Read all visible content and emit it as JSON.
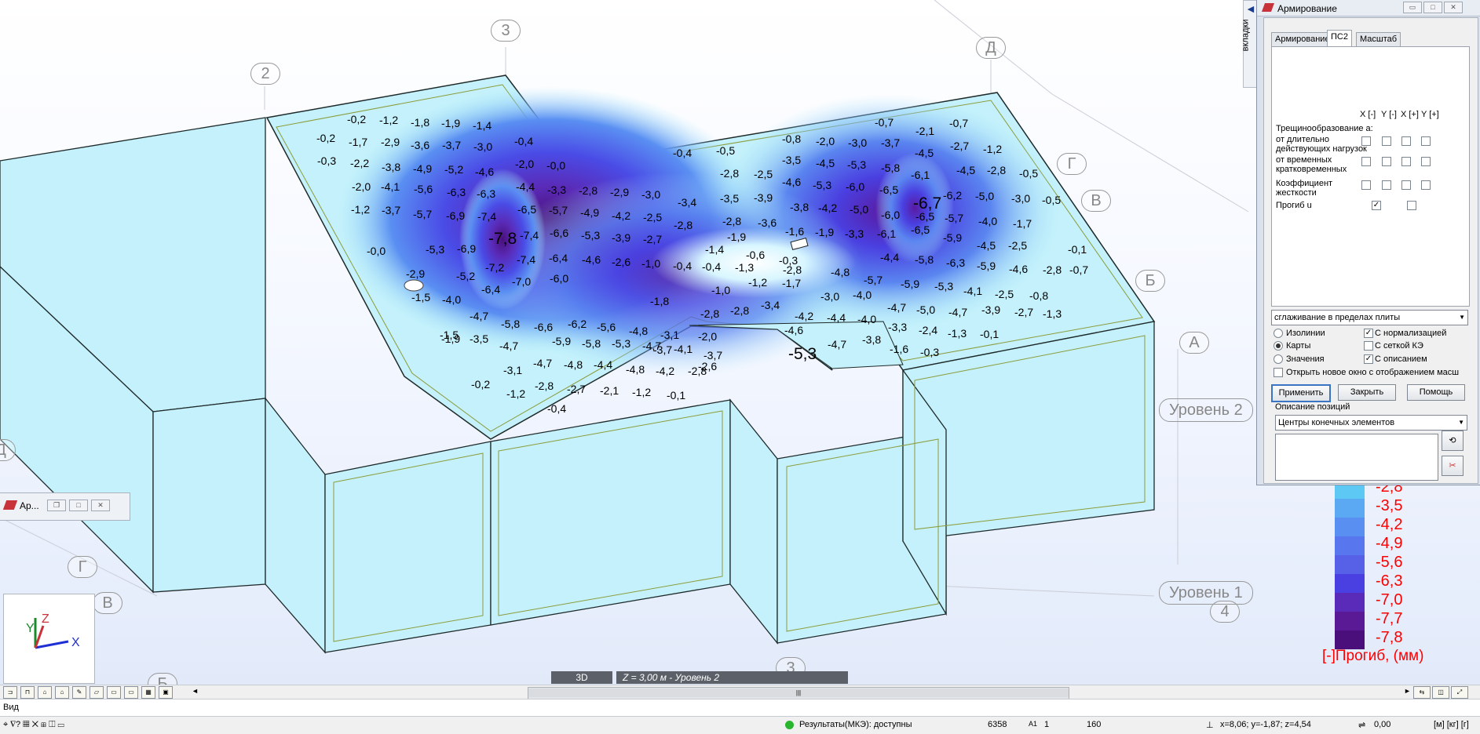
{
  "grid_axes": {
    "labels": [
      "3",
      "2",
      "Д",
      "Г",
      "В",
      "Б",
      "А",
      "Д",
      "Г",
      "В",
      "Б",
      "3",
      "4"
    ]
  },
  "levels": [
    "Уровень 2",
    "Уровень 1"
  ],
  "contour_values": [
    [
      "-0,2",
      "-1,2",
      "-1,8",
      "-1,9",
      "-1,4"
    ],
    [
      "-0,2",
      "-1,7",
      "-2,9",
      "-3,6",
      "-3,7",
      "-3,0",
      "-0,4"
    ],
    [
      "-0,3",
      "-2,2",
      "-3,8",
      "-4,9",
      "-5,2",
      "-4,6",
      "-2,0",
      "-0,0"
    ],
    [
      "-2,0",
      "-4,1",
      "-5,6",
      "-6,3",
      "-6,3",
      "-4,4",
      "-3,3",
      "-2,8",
      "-2,9",
      "-3,0"
    ],
    [
      "-1,2",
      "-3,7",
      "-5,7",
      "-6,9",
      "-7,4",
      "-6,5",
      "-5,7",
      "-4,9",
      "-4,2",
      "-2,5"
    ],
    [
      "-0,0",
      "-5,3",
      "-6,9",
      "-7,8",
      "-7,4",
      "-6,6",
      "-5,3",
      "-3,9",
      "-2,7"
    ],
    [
      "-2,9",
      "-5,2",
      "-7,2",
      "-7,4",
      "-6,4",
      "-4,6",
      "-2,6",
      "-1,0"
    ],
    [
      "-1,5",
      "-4,0",
      "-6,4",
      "-7,0",
      "-6,0"
    ],
    [
      "-1,5",
      "-4,7",
      "-5,8",
      "-6,6",
      "-6,2",
      "-5,6",
      "-4,8",
      "-3,1",
      "-2,0",
      "-1,8"
    ],
    [
      "-1,9",
      "-3,5",
      "-4,7",
      "-5,9",
      "-5,8",
      "-5,3",
      "-4,7",
      "-4,1",
      "-3,7"
    ],
    [
      "-0,2",
      "-3,1",
      "-4,7",
      "-4,8",
      "-4,4",
      "-4,8",
      "-4,2"
    ],
    [
      "-1,2",
      "-2,8",
      "-2,7",
      "-2,1",
      "-1,2",
      "-0,1",
      "-3,7",
      "-2,8",
      "-2,6"
    ],
    [
      "-0,4"
    ],
    [
      "-0,7",
      "-2,1",
      "-0,7"
    ],
    [
      "-0,4",
      "-0,5",
      "-0,8",
      "-2,0",
      "-3,0",
      "-3,7",
      "-4,5",
      "-2,7",
      "-1,2"
    ],
    [
      "-2,8",
      "-2,5",
      "-3,5",
      "-4,5",
      "-5,3",
      "-5,8",
      "-6,1",
      "-4,5",
      "-2,8",
      "-0,5"
    ],
    [
      "-3,4",
      "-3,5",
      "-3,9",
      "-4,6",
      "-5,3",
      "-6,0",
      "-6,5",
      "-6,7",
      "-6,2",
      "-5,0",
      "-3,0",
      "-0,5"
    ],
    [
      "-2,8",
      "-2,8",
      "-3,6",
      "-3,8",
      "-4,2",
      "-5,0",
      "-6,0",
      "-6,5",
      "-5,7",
      "-4,0",
      "-1,7"
    ],
    [
      "-1,9",
      "-1,6",
      "-1,9",
      "-3,3",
      "-6,1",
      "-6,5",
      "-5,9",
      "-4,5",
      "-2,5",
      "-0,1"
    ],
    [
      "-1,4",
      "-0,6",
      "-0,3",
      "-4,4",
      "-5,8",
      "-6,3",
      "-5,9",
      "-4,6",
      "-2,8",
      "-0,7"
    ],
    [
      "-0,4",
      "-0,4",
      "-1,3",
      "-2,8",
      "-4,8",
      "-5,7",
      "-5,9",
      "-5,3",
      "-4,1",
      "-2,5",
      "-0,8"
    ],
    [
      "-1,0",
      "-1,2",
      "-1,7",
      "-3,0",
      "-4,0",
      "-4,7",
      "-5,0",
      "-4,7",
      "-3,9",
      "-2,7",
      "-1,3"
    ],
    [
      "-2,8",
      "-2,8",
      "-3,4",
      "-4,2",
      "-4,4",
      "-4,0",
      "-3,3",
      "-2,4",
      "-1,3",
      "-0,1"
    ],
    [
      "-4,6",
      "-5,3",
      "-4,7",
      "-3,8",
      "-1,6",
      "-0,3"
    ]
  ],
  "panel": {
    "title": "Армирование",
    "side_tab": "вкладки",
    "tabs": [
      "Армирование",
      "ПС2",
      "Масштаб"
    ],
    "col_headers": [
      "X [-]",
      "Y [-]",
      "X [+]",
      "Y [+]"
    ],
    "crack_title": "Трещинообразование a:",
    "rows": [
      {
        "label": "от длительно\nдействующих нагрузок"
      },
      {
        "label": "от временных\nкратковременных"
      },
      {
        "label": "Коэффициент\nжесткости"
      },
      {
        "label": "Прогиб u"
      }
    ],
    "smoothing": "сглаживание в пределах плиты",
    "display_modes": [
      "Изолинии",
      "Карты",
      "Значения"
    ],
    "display_selected": "Карты",
    "options": [
      {
        "label": "С нормализацией",
        "checked": true
      },
      {
        "label": "С сеткой КЭ",
        "checked": false
      },
      {
        "label": "С описанием",
        "checked": true
      }
    ],
    "new_window": "Открыть новое окно с отображением масш",
    "buttons": {
      "apply": "Применить",
      "close": "Закрыть",
      "help": "Помощь"
    },
    "positions_label": "Описание позиций",
    "positions_value": "Центры конечных элементов"
  },
  "legend": {
    "values": [
      "-2,8",
      "-3,5",
      "-4,2",
      "-4,9",
      "-5,6",
      "-6,3",
      "-7,0",
      "-7,7",
      "-7,8"
    ],
    "colors": [
      "#5ec8f5",
      "#5aa9f2",
      "#5a8ff2",
      "#5877ee",
      "#5661e8",
      "#4a3fe0",
      "#5a2bb8",
      "#5a1a96",
      "#4a0f7a"
    ],
    "title": "[-]Прогиб, (мм)"
  },
  "minimized_window": {
    "title": "Ар..."
  },
  "axes_widget": {
    "x": "X",
    "y": "Y",
    "z": "Z"
  },
  "view_bar": {
    "mode": "3D",
    "level": "Z = 3,00 м - Уровень 2"
  },
  "command_line": "Вид",
  "status": {
    "results": "Результаты(МКЭ): доступны",
    "count": "6358",
    "a1": "A1",
    "one": "1",
    "n160": "160",
    "coords": "x=8,06; y=-1,87; z=4,54",
    "value": "0,00",
    "units": "[м] [кг] [г]"
  }
}
